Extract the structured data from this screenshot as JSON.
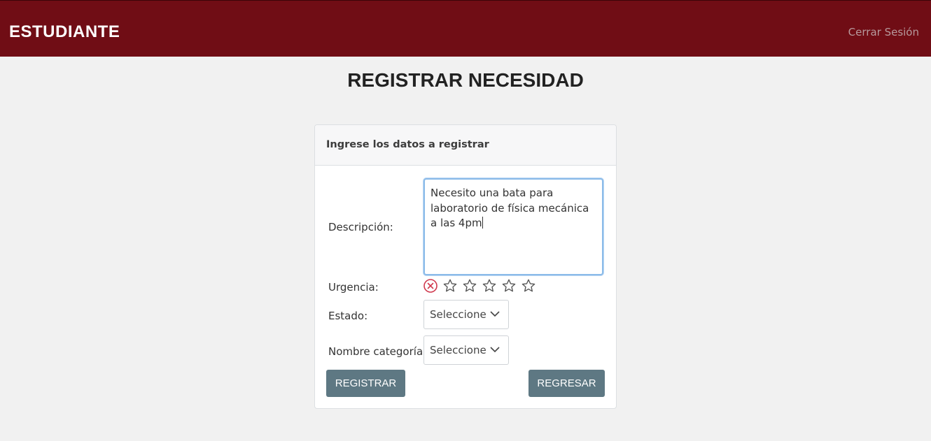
{
  "navbar": {
    "brand": "ESTUDIANTE",
    "logout": "Cerrar Sesión"
  },
  "page": {
    "title": "REGISTRAR NECESIDAD"
  },
  "card": {
    "header": "Ingrese los datos a registrar"
  },
  "form": {
    "description_label": "Descripción:",
    "description_value": "Necesito una bata para laboratorio de física mecánica a las 4pm",
    "urgency_label": "Urgencia:",
    "urgency_rating": 0,
    "urgency_max": 5,
    "status_label": "Estado:",
    "status_value": "Seleccione",
    "category_label": "Nombre categoría:",
    "category_value": "Seleccione"
  },
  "buttons": {
    "register": "REGISTRAR",
    "back": "REGRESAR"
  },
  "colors": {
    "navbar": "#700d15",
    "button": "#5e7883",
    "clear_icon": "#d0394e"
  },
  "icons": {
    "clear": "x-circle-icon",
    "star": "star-outline-icon",
    "chevron": "chevron-down-icon"
  }
}
